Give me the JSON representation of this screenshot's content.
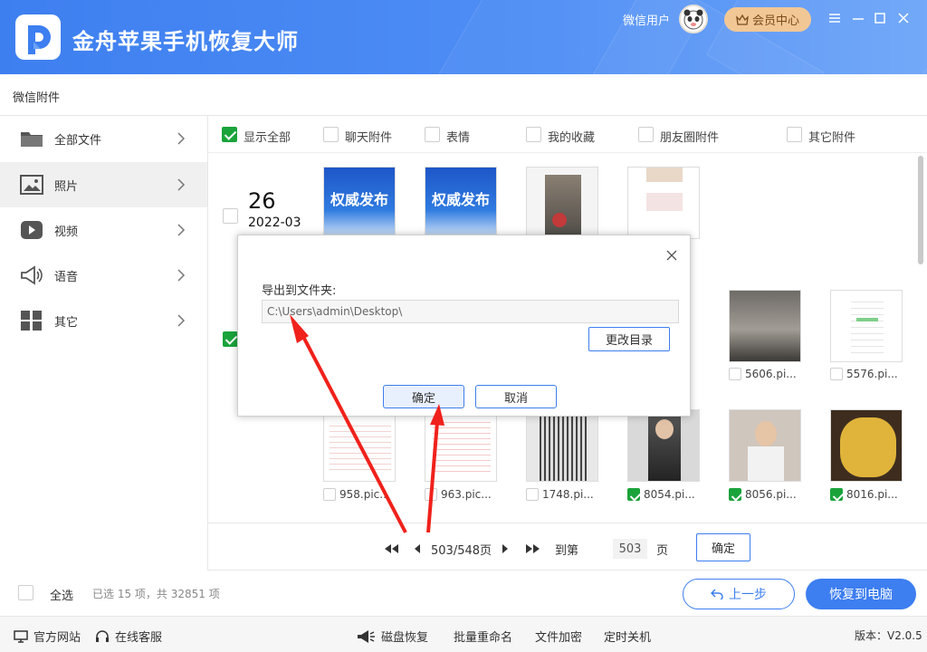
{
  "app": {
    "title": "金舟苹果手机恢复大师",
    "user": "微信用户",
    "vip": "会员中心"
  },
  "subbar": {
    "title": "微信附件"
  },
  "sidebar": {
    "items": [
      {
        "label": "全部文件",
        "icon": "folder-icon"
      },
      {
        "label": "照片",
        "icon": "image-icon"
      },
      {
        "label": "视频",
        "icon": "video-icon"
      },
      {
        "label": "语音",
        "icon": "speaker-icon"
      },
      {
        "label": "其它",
        "icon": "grid-icon"
      }
    ]
  },
  "filters": [
    {
      "label": "显示全部",
      "checked": true
    },
    {
      "label": "聊天附件",
      "checked": false
    },
    {
      "label": "表情",
      "checked": false
    },
    {
      "label": "我的收藏",
      "checked": false
    },
    {
      "label": "朋友圈附件",
      "checked": false
    },
    {
      "label": "其它附件",
      "checked": false
    }
  ],
  "groups": [
    {
      "day": "26",
      "ym": "2022-03"
    }
  ],
  "thumb_text": {
    "gov": "权威发布"
  },
  "files": [
    {
      "name": "5606.pi...",
      "checked": false
    },
    {
      "name": "5576.pi...",
      "checked": false
    },
    {
      "name": "958.pic...",
      "checked": false
    },
    {
      "name": "963.pic...",
      "checked": false
    },
    {
      "name": "1748.pi...",
      "checked": false
    },
    {
      "name": "8054.pi...",
      "checked": true
    },
    {
      "name": "8056.pi...",
      "checked": true
    },
    {
      "name": "8016.pi...",
      "checked": true
    }
  ],
  "pager": {
    "status": "503/548页",
    "goto": "到第",
    "page": "503",
    "unit": "页",
    "ok": "确定"
  },
  "bottom": {
    "select_all": "全选",
    "summary": "已选 15 项，共 32851 项",
    "prev": "上一步",
    "recover": "恢复到电脑"
  },
  "footer": {
    "website": "官方网站",
    "service": "在线客服",
    "disk": "磁盘恢复",
    "rename": "批量重命名",
    "encrypt": "文件加密",
    "shutdown": "定时关机",
    "version": "版本：V2.0.5"
  },
  "dialog": {
    "label": "导出到文件夹:",
    "path": "C:\\Users\\admin\\Desktop\\",
    "change": "更改目录",
    "ok": "确定",
    "cancel": "取消"
  },
  "colors": {
    "accent": "#3d7ef0",
    "check": "#1aa33b",
    "arrow": "#f0211b",
    "header": "#4f8ef5"
  }
}
